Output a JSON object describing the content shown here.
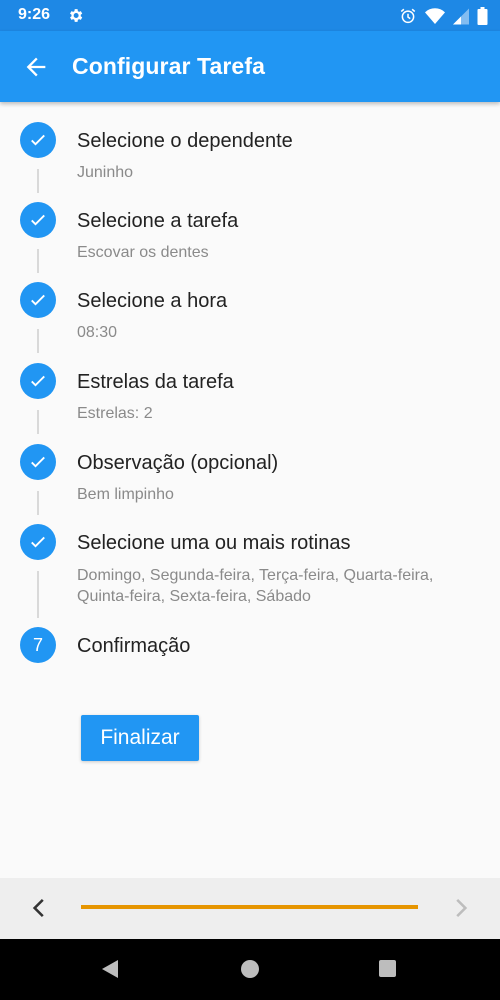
{
  "status_bar": {
    "time": "9:26"
  },
  "app_bar": {
    "title": "Configurar Tarefa"
  },
  "steps": [
    {
      "title": "Selecione o dependente",
      "subtitle": "Juninho"
    },
    {
      "title": "Selecione a tarefa",
      "subtitle": "Escovar os dentes"
    },
    {
      "title": "Selecione a hora",
      "subtitle": "08:30"
    },
    {
      "title": "Estrelas da tarefa",
      "subtitle": "Estrelas: 2"
    },
    {
      "title": "Observação (opcional)",
      "subtitle": "Bem limpinho"
    },
    {
      "title": "Selecione uma ou mais rotinas",
      "subtitle": "Domingo, Segunda-feira, Terça-feira, Quarta-feira, Quinta-feira, Sexta-feira, Sábado"
    },
    {
      "title": "Confirmação",
      "number": "7"
    }
  ],
  "finalize_label": "Finalizar",
  "progress": {
    "fraction": 1.0,
    "color": "#e69500"
  },
  "colors": {
    "primary": "#2196f3",
    "status_bar": "#1e88e5"
  }
}
